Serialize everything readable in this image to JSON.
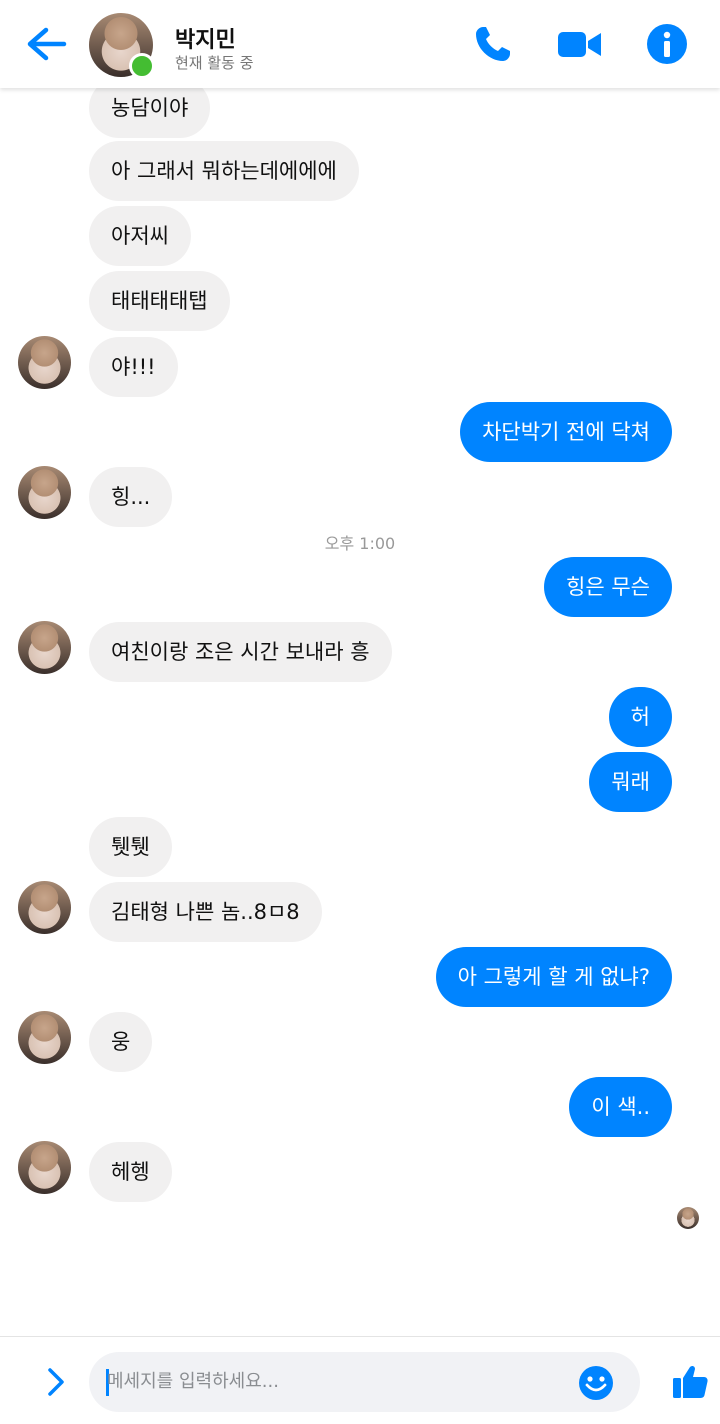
{
  "header": {
    "name": "박지민",
    "status": "현재 활동 중"
  },
  "colors": {
    "accent": "#0084ff",
    "incoming_bubble": "#f1f0f0",
    "online": "#44bd32"
  },
  "icons": {
    "back": "arrow-left-icon",
    "call": "phone-icon",
    "video": "video-camera-icon",
    "info": "info-icon",
    "expand": "chevron-right-icon",
    "emoji": "smiley-icon",
    "like": "thumbs-up-icon"
  },
  "messages": [
    {
      "text": "농담이야",
      "from": "them"
    },
    {
      "text": "아 그래서 뭐하는데에에에",
      "from": "them"
    },
    {
      "text": "아저씨",
      "from": "them"
    },
    {
      "text": "태태태태탭",
      "from": "them"
    },
    {
      "text": "야!!!",
      "from": "them"
    },
    {
      "text": "차단박기 전에 닥쳐",
      "from": "me"
    },
    {
      "text": "힝...",
      "from": "them"
    },
    {
      "text": "힝은 무슨",
      "from": "me"
    },
    {
      "text": "여친이랑 조은 시간 보내라 흥",
      "from": "them"
    },
    {
      "text": "허",
      "from": "me"
    },
    {
      "text": "뭐래",
      "from": "me"
    },
    {
      "text": "퉷퉷",
      "from": "them"
    },
    {
      "text": "김태형 나쁜 놈..8ㅁ8",
      "from": "them"
    },
    {
      "text": "아 그렇게 할 게 없냐?",
      "from": "me"
    },
    {
      "text": "웅",
      "from": "them"
    },
    {
      "text": "이 색..",
      "from": "me"
    },
    {
      "text": "헤헹",
      "from": "them"
    }
  ],
  "timestamp": "오후 1:00",
  "composer": {
    "placeholder": "메세지를 입력하세요..."
  }
}
